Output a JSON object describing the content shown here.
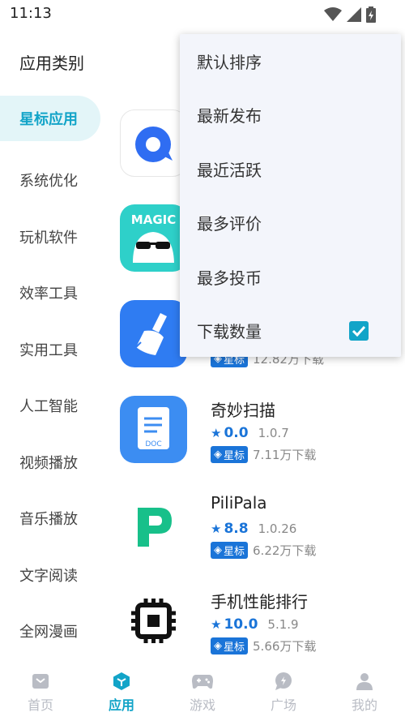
{
  "status_bar": {
    "time": "11:13"
  },
  "category_panel": {
    "title": "应用类别",
    "items": [
      {
        "label": "星标应用",
        "active": true
      },
      {
        "label": "系统优化"
      },
      {
        "label": "玩机软件"
      },
      {
        "label": "效率工具"
      },
      {
        "label": "实用工具"
      },
      {
        "label": "人工智能"
      },
      {
        "label": "视频播放"
      },
      {
        "label": "音乐播放"
      },
      {
        "label": "文字阅读"
      },
      {
        "label": "全网漫画"
      }
    ]
  },
  "apps": [
    {
      "icon": "q-chat-icon"
    },
    {
      "icon": "magic-icon",
      "icon_text": "MAGIC"
    },
    {
      "icon": "broom-icon",
      "badge": "星标",
      "downloads": "12.82万下载"
    },
    {
      "icon": "scan-doc-icon",
      "icon_text": "DOC",
      "name": "奇妙扫描",
      "rating": "0.0",
      "version": "1.0.7",
      "badge": "星标",
      "downloads": "7.11万下载"
    },
    {
      "icon": "pilipala-icon",
      "name": "PiliPala",
      "rating": "8.8",
      "version": "1.0.26",
      "badge": "星标",
      "downloads": "6.22万下载"
    },
    {
      "icon": "chip-icon",
      "name": "手机性能排行",
      "rating": "10.0",
      "version": "5.1.9",
      "badge": "星标",
      "downloads": "5.66万下载"
    }
  ],
  "sort_menu": {
    "items": [
      {
        "label": "默认排序"
      },
      {
        "label": "最新发布"
      },
      {
        "label": "最近活跃"
      },
      {
        "label": "最多评价"
      },
      {
        "label": "最多投币"
      },
      {
        "label": "下载数量",
        "checked": true
      }
    ]
  },
  "bottom_nav": {
    "items": [
      {
        "label": "首页",
        "icon": "home-icon"
      },
      {
        "label": "应用",
        "icon": "cube-icon",
        "active": true
      },
      {
        "label": "游戏",
        "icon": "gamepad-icon"
      },
      {
        "label": "广场",
        "icon": "chat-bubble-icon"
      },
      {
        "label": "我的",
        "icon": "person-icon"
      }
    ]
  },
  "colors": {
    "accent": "#12a4c8",
    "rating_blue": "#1a74d8",
    "active_bg": "#e3f5f8"
  }
}
